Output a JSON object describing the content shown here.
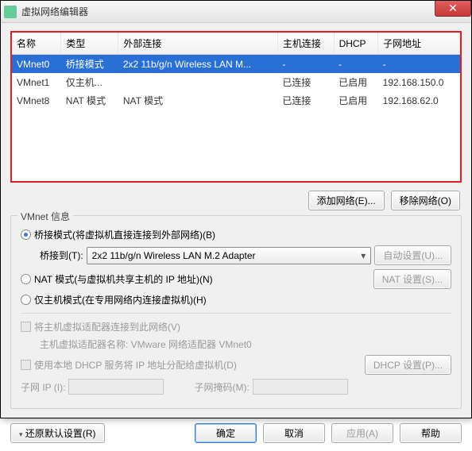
{
  "title": "虚拟网络编辑器",
  "table": {
    "cols": {
      "name": "名称",
      "type": "类型",
      "ext": "外部连接",
      "host": "主机连接",
      "dhcp": "DHCP",
      "subnet": "子网地址"
    },
    "rows": [
      {
        "name": "VMnet0",
        "type": "桥接模式",
        "ext": "2x2 11b/g/n Wireless LAN M...",
        "host": "-",
        "dhcp": "-",
        "subnet": "-",
        "selected": true
      },
      {
        "name": "VMnet1",
        "type": "仅主机...",
        "ext": "",
        "host": "已连接",
        "dhcp": "已启用",
        "subnet": "192.168.150.0"
      },
      {
        "name": "VMnet8",
        "type": "NAT 模式",
        "ext": "NAT 模式",
        "host": "已连接",
        "dhcp": "已启用",
        "subnet": "192.168.62.0"
      }
    ]
  },
  "buttons": {
    "addNet": "添加网络(E)...",
    "removeNet": "移除网络(O)",
    "autoSet": "自动设置(U)...",
    "natSet": "NAT 设置(S)...",
    "dhcpSet": "DHCP 设置(P)...",
    "restore": "还原默认设置(R)",
    "ok": "确定",
    "cancel": "取消",
    "apply": "应用(A)",
    "help": "帮助"
  },
  "group": {
    "title": "VMnet 信息",
    "optBridge": "桥接模式(将虚拟机直接连接到外部网络)(B)",
    "bridgeToLabel": "桥接到(T):",
    "bridgeToValue": "2x2 11b/g/n Wireless LAN M.2 Adapter",
    "optNat": "NAT 模式(与虚拟机共享主机的 IP 地址)(N)",
    "optHostOnly": "仅主机模式(在专用网络内连接虚拟机)(H)",
    "chkHostAdapter": "将主机虚拟适配器连接到此网络(V)",
    "hostAdapterName": "主机虚拟适配器名称: VMware 网络适配器 VMnet0",
    "chkDhcp": "使用本地 DHCP 服务将 IP 地址分配给虚拟机(D)",
    "subnetIpLabel": "子网 IP (I):",
    "subnetMaskLabel": "子网掩码(M):"
  }
}
